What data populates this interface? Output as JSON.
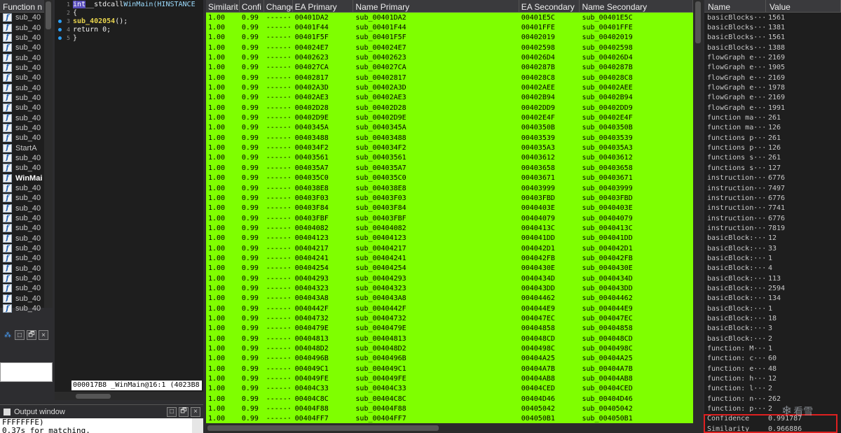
{
  "functions_panel": {
    "header": "Function n",
    "items": [
      "sub_40",
      "sub_40",
      "sub_40",
      "sub_40",
      "sub_40",
      "sub_40",
      "sub_40",
      "sub_40",
      "sub_40",
      "sub_40",
      "sub_40",
      "sub_40",
      "sub_40",
      "StartA",
      "sub_40",
      "sub_40",
      "WinMai",
      "sub_40",
      "sub_40",
      "sub_40",
      "sub_40",
      "sub_40",
      "sub_40",
      "sub_40",
      "sub_40",
      "sub_40",
      "sub_40",
      "sub_40",
      "sub_40",
      "sub_40"
    ],
    "bold_index": 16,
    "control_buttons": [
      "□",
      "🗗",
      "×"
    ]
  },
  "pseudocode": {
    "lines": [
      {
        "num": "1",
        "dot": false,
        "parts": [
          [
            "kw",
            "int"
          ],
          [
            "txt",
            " __stdcall "
          ],
          [
            "ty",
            "WinMain(HINSTANCE"
          ]
        ]
      },
      {
        "num": "2",
        "dot": false,
        "parts": [
          [
            "txt",
            "{"
          ]
        ]
      },
      {
        "num": "3",
        "dot": true,
        "parts": [
          [
            "txt",
            "  "
          ],
          [
            "fn",
            "sub_402054"
          ],
          [
            "txt",
            "();"
          ]
        ]
      },
      {
        "num": "4",
        "dot": true,
        "parts": [
          [
            "txt",
            "  return 0;"
          ]
        ]
      },
      {
        "num": "5",
        "dot": true,
        "parts": [
          [
            "txt",
            "}"
          ]
        ]
      }
    ],
    "status": "000017B8 _WinMain@16:1 (4023B8"
  },
  "output_window": {
    "title": "Output window",
    "lines": [
      "FFFFFFFE)",
      "0.37s for matching."
    ]
  },
  "match_table": {
    "columns": [
      "Similarit",
      "Confi",
      "Change",
      "EA Primary",
      "Name Primary",
      "EA Secondary",
      "Name Secondary"
    ],
    "rows": [
      [
        "1.00",
        "0.99",
        "-----···",
        "00401DA2",
        "sub_00401DA2",
        "00401E5C",
        "sub_00401E5C"
      ],
      [
        "1.00",
        "0.99",
        "-----···",
        "00401F44",
        "sub_00401F44",
        "00401FFE",
        "sub_00401FFE"
      ],
      [
        "1.00",
        "0.99",
        "-----···",
        "00401F5F",
        "sub_00401F5F",
        "00402019",
        "sub_00402019"
      ],
      [
        "1.00",
        "0.99",
        "-----···",
        "004024E7",
        "sub_004024E7",
        "00402598",
        "sub_00402598"
      ],
      [
        "1.00",
        "0.99",
        "-----···",
        "00402623",
        "sub_00402623",
        "004026D4",
        "sub_004026D4"
      ],
      [
        "1.00",
        "0.99",
        "-----···",
        "004027CA",
        "sub_004027CA",
        "0040287B",
        "sub_0040287B"
      ],
      [
        "1.00",
        "0.99",
        "-----···",
        "00402817",
        "sub_00402817",
        "004028C8",
        "sub_004028C8"
      ],
      [
        "1.00",
        "0.99",
        "-----···",
        "00402A3D",
        "sub_00402A3D",
        "00402AEE",
        "sub_00402AEE"
      ],
      [
        "1.00",
        "0.99",
        "-----···",
        "00402AE3",
        "sub_00402AE3",
        "00402B94",
        "sub_00402B94"
      ],
      [
        "1.00",
        "0.99",
        "-----···",
        "00402D28",
        "sub_00402D28",
        "00402DD9",
        "sub_00402DD9"
      ],
      [
        "1.00",
        "0.99",
        "-----···",
        "00402D9E",
        "sub_00402D9E",
        "00402E4F",
        "sub_00402E4F"
      ],
      [
        "1.00",
        "0.99",
        "-----···",
        "0040345A",
        "sub_0040345A",
        "0040350B",
        "sub_0040350B"
      ],
      [
        "1.00",
        "0.99",
        "-----···",
        "00403488",
        "sub_00403488",
        "00403539",
        "sub_00403539"
      ],
      [
        "1.00",
        "0.99",
        "-----···",
        "004034F2",
        "sub_004034F2",
        "004035A3",
        "sub_004035A3"
      ],
      [
        "1.00",
        "0.99",
        "-----···",
        "00403561",
        "sub_00403561",
        "00403612",
        "sub_00403612"
      ],
      [
        "1.00",
        "0.99",
        "-----···",
        "004035A7",
        "sub_004035A7",
        "00403658",
        "sub_00403658"
      ],
      [
        "1.00",
        "0.99",
        "-----···",
        "004035C0",
        "sub_004035C0",
        "00403671",
        "sub_00403671"
      ],
      [
        "1.00",
        "0.99",
        "-----···",
        "004038E8",
        "sub_004038E8",
        "00403999",
        "sub_00403999"
      ],
      [
        "1.00",
        "0.99",
        "-----···",
        "00403F03",
        "sub_00403F03",
        "00403FBD",
        "sub_00403FBD"
      ],
      [
        "1.00",
        "0.99",
        "-----···",
        "00403F84",
        "sub_00403F84",
        "0040403E",
        "sub_0040403E"
      ],
      [
        "1.00",
        "0.99",
        "-----···",
        "00403FBF",
        "sub_00403FBF",
        "00404079",
        "sub_00404079"
      ],
      [
        "1.00",
        "0.99",
        "-----···",
        "00404082",
        "sub_00404082",
        "0040413C",
        "sub_0040413C"
      ],
      [
        "1.00",
        "0.99",
        "-----···",
        "00404123",
        "sub_00404123",
        "004041DD",
        "sub_004041DD"
      ],
      [
        "1.00",
        "0.99",
        "-----···",
        "00404217",
        "sub_00404217",
        "004042D1",
        "sub_004042D1"
      ],
      [
        "1.00",
        "0.99",
        "-----···",
        "00404241",
        "sub_00404241",
        "004042FB",
        "sub_004042FB"
      ],
      [
        "1.00",
        "0.99",
        "-----···",
        "00404254",
        "sub_00404254",
        "0040430E",
        "sub_0040430E"
      ],
      [
        "1.00",
        "0.99",
        "-----···",
        "00404293",
        "sub_00404293",
        "0040434D",
        "sub_0040434D"
      ],
      [
        "1.00",
        "0.99",
        "-----···",
        "00404323",
        "sub_00404323",
        "004043DD",
        "sub_004043DD"
      ],
      [
        "1.00",
        "0.99",
        "-----···",
        "004043A8",
        "sub_004043A8",
        "00404462",
        "sub_00404462"
      ],
      [
        "1.00",
        "0.99",
        "-----···",
        "0040442F",
        "sub_0040442F",
        "004044E9",
        "sub_004044E9"
      ],
      [
        "1.00",
        "0.99",
        "-----···",
        "00404732",
        "sub_00404732",
        "004047EC",
        "sub_004047EC"
      ],
      [
        "1.00",
        "0.99",
        "-----···",
        "0040479E",
        "sub_0040479E",
        "00404858",
        "sub_00404858"
      ],
      [
        "1.00",
        "0.99",
        "-----···",
        "00404813",
        "sub_00404813",
        "004048CD",
        "sub_004048CD"
      ],
      [
        "1.00",
        "0.99",
        "-----···",
        "004048D2",
        "sub_004048D2",
        "0040498C",
        "sub_0040498C"
      ],
      [
        "1.00",
        "0.99",
        "-----···",
        "0040496B",
        "sub_0040496B",
        "00404A25",
        "sub_00404A25"
      ],
      [
        "1.00",
        "0.99",
        "-----···",
        "004049C1",
        "sub_004049C1",
        "00404A7B",
        "sub_00404A7B"
      ],
      [
        "1.00",
        "0.99",
        "-----···",
        "004049FE",
        "sub_004049FE",
        "00404AB8",
        "sub_00404AB8"
      ],
      [
        "1.00",
        "0.99",
        "-----···",
        "00404C33",
        "sub_00404C33",
        "00404CED",
        "sub_00404CED"
      ],
      [
        "1.00",
        "0.99",
        "-----···",
        "00404C8C",
        "sub_00404C8C",
        "00404D46",
        "sub_00404D46"
      ],
      [
        "1.00",
        "0.99",
        "-----···",
        "00404F88",
        "sub_00404F88",
        "00405042",
        "sub_00405042"
      ],
      [
        "1.00",
        "0.99",
        "-----···",
        "00404FF7",
        "sub_00404FF7",
        "004050B1",
        "sub_004050B1"
      ]
    ],
    "row_color": "#7fff00"
  },
  "properties": {
    "columns": [
      "Name",
      "Value"
    ],
    "rows": [
      [
        "basicBlocks···",
        "1561"
      ],
      [
        "basicBlocks···",
        "1381"
      ],
      [
        "basicBlocks···",
        "1561"
      ],
      [
        "basicBlocks···",
        "1388"
      ],
      [
        "flowGraph e···",
        "2169"
      ],
      [
        "flowGraph e···",
        "1905"
      ],
      [
        "flowGraph e···",
        "2169"
      ],
      [
        "flowGraph e···",
        "1978"
      ],
      [
        "flowGraph e···",
        "2169"
      ],
      [
        "flowGraph e···",
        "1991"
      ],
      [
        "function ma···",
        "261"
      ],
      [
        "function ma···",
        "126"
      ],
      [
        "functions p···",
        "261"
      ],
      [
        "functions p···",
        "126"
      ],
      [
        "functions s···",
        "261"
      ],
      [
        "functions s···",
        "127"
      ],
      [
        "instruction···",
        "6776"
      ],
      [
        "instruction···",
        "7497"
      ],
      [
        "instruction···",
        "6776"
      ],
      [
        "instruction···",
        "7741"
      ],
      [
        "instruction···",
        "6776"
      ],
      [
        "instruction···",
        "7819"
      ],
      [
        "basicBlock:···",
        "12"
      ],
      [
        "basicBlock:···",
        "33"
      ],
      [
        "basicBlock:···",
        "1"
      ],
      [
        "basicBlock:···",
        "4"
      ],
      [
        "basicBlock:···",
        "113"
      ],
      [
        "basicBlock:···",
        "2594"
      ],
      [
        "basicBlock:···",
        "134"
      ],
      [
        "basicBlock:···",
        "1"
      ],
      [
        "basicBlock:···",
        "18"
      ],
      [
        "basicBlock:···",
        "3"
      ],
      [
        "basicBlock:···",
        "2"
      ],
      [
        "function: M···",
        "1"
      ],
      [
        "function: c···",
        "60"
      ],
      [
        "function: e···",
        "48"
      ],
      [
        "function: h···",
        "12"
      ],
      [
        "function: l···",
        "2"
      ],
      [
        "function: n···",
        "262"
      ],
      [
        "function: p···",
        "2"
      ],
      [
        "Confidence",
        "0.991787"
      ],
      [
        "Similarity",
        "0.966886"
      ]
    ],
    "highlight_color": "#e02020"
  },
  "watermark": {
    "text": "看雪",
    "icon": "snowflake-icon"
  }
}
